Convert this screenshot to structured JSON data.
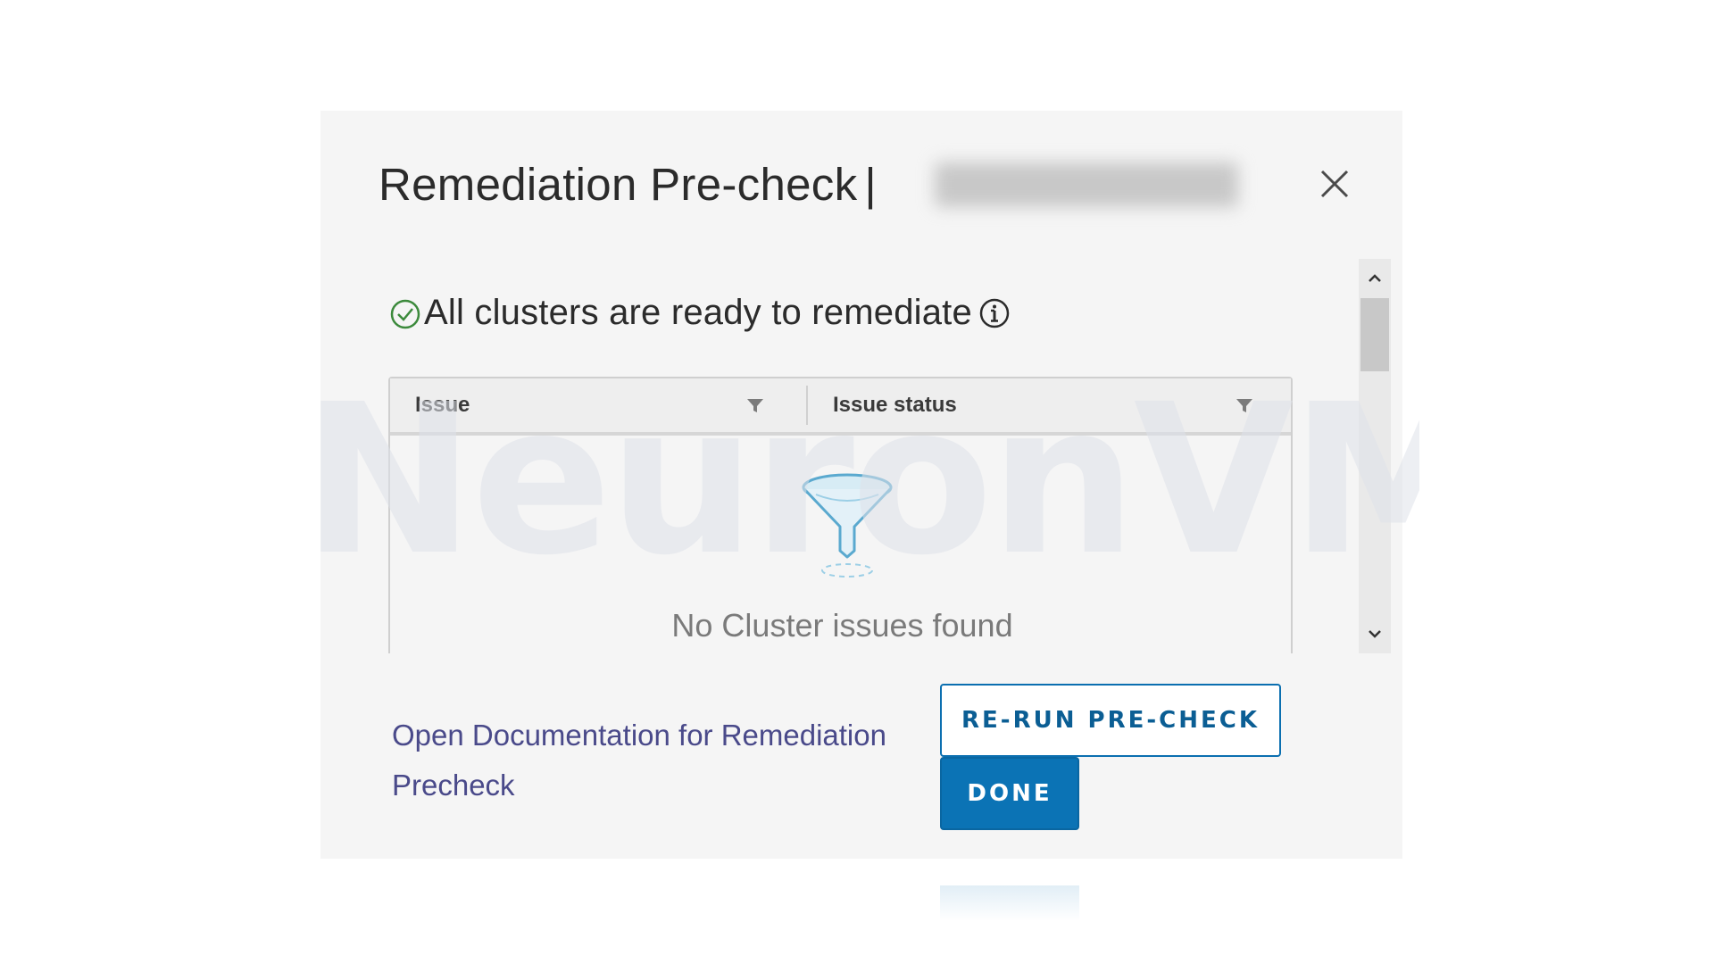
{
  "dialog": {
    "title": "Remediation Pre-check",
    "title_separator": "|"
  },
  "status": {
    "message": "All clusters are ready to remediate",
    "check_icon": "check-circle-icon",
    "info_icon": "info-circle-icon"
  },
  "grid": {
    "columns": [
      {
        "label": "Issue"
      },
      {
        "label": "Issue status"
      }
    ],
    "empty_message": "No Cluster issues found"
  },
  "footer": {
    "doc_link": "Open Documentation for Remediation Precheck",
    "rerun_label": "RE-RUN PRE-CHECK",
    "done_label": "DONE"
  },
  "watermark": "NeuronVM",
  "colors": {
    "primary": "#0b73b5",
    "success": "#3c8a3c",
    "link": "#4a4a8a"
  }
}
